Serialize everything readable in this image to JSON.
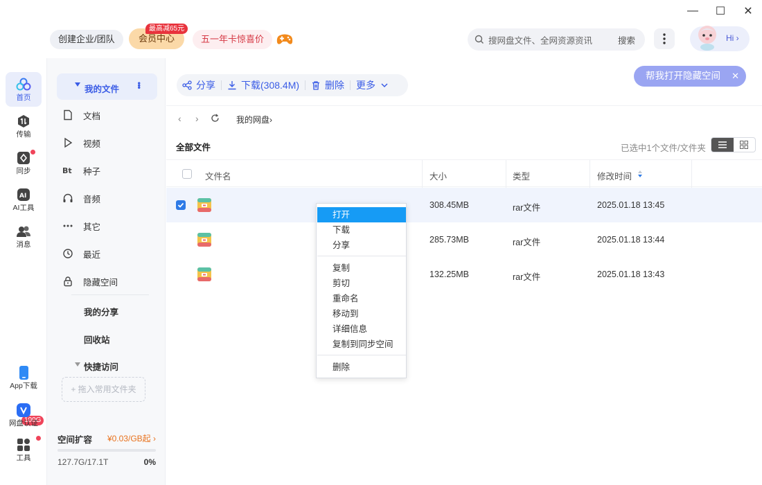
{
  "window": {
    "minimize": "—",
    "maximize": "☐",
    "close": "✕"
  },
  "topbar": {
    "enterprise": "创建企业/团队",
    "vip_tag": "最高减65元",
    "vip": "会员中心",
    "promo": "五一年卡惊喜价",
    "search_placeholder": "搜网盘文件、全网资源资讯",
    "search_go": "搜索",
    "hi": "Hi ›"
  },
  "rail": {
    "items": [
      {
        "label": "首页",
        "icon": "cloud-icon"
      },
      {
        "label": "传输",
        "icon": "transfer-icon"
      },
      {
        "label": "同步",
        "icon": "sync-icon"
      },
      {
        "label": "AI工具",
        "icon": "ai-icon"
      },
      {
        "label": "消息",
        "icon": "message-icon"
      }
    ],
    "app_badge": "100G",
    "app_download": "App下载",
    "verify": "网盘认证",
    "tools": "工具"
  },
  "sidebar": {
    "my_files": "我的文件",
    "items": [
      {
        "label": "文档",
        "icon": "document-icon"
      },
      {
        "label": "视频",
        "icon": "video-icon"
      },
      {
        "label": "种子",
        "icon": "torrent-icon"
      },
      {
        "label": "音频",
        "icon": "audio-icon"
      },
      {
        "label": "其它",
        "icon": "other-icon"
      },
      {
        "label": "最近",
        "icon": "recent-icon"
      },
      {
        "label": "隐藏空间",
        "icon": "lock-icon"
      }
    ],
    "my_share": "我的分享",
    "recycle": "回收站",
    "quick_access": "快捷访问",
    "drop_hint": "+ 拖入常用文件夹",
    "space_title": "空间扩容",
    "space_price": "¥0.03/GB起 ›",
    "space_used": "127.7G/17.1T",
    "space_pct": "0%",
    "space_fraction": 0.0
  },
  "toolbar": {
    "share": "分享",
    "download": "下载(308.4M)",
    "delete": "删除",
    "more": "更多"
  },
  "hidden_space_btn": "帮我打开隐藏空间",
  "breadcrumb": "我的网盘›",
  "list": {
    "title": "全部文件",
    "selection_info": "已选中1个文件/文件夹",
    "columns": [
      "文件名",
      "大小",
      "类型",
      "修改时间"
    ],
    "rows": [
      {
        "size": "308.45MB",
        "type": "rar文件",
        "modified": "2025.01.18 13:45",
        "selected": true
      },
      {
        "size": "285.73MB",
        "type": "rar文件",
        "modified": "2025.01.18 13:44",
        "selected": false
      },
      {
        "size": "132.25MB",
        "type": "rar文件",
        "modified": "2025.01.18 13:43",
        "selected": false
      }
    ]
  },
  "context_menu": {
    "items": [
      "打开",
      "下载",
      "分享",
      "复制",
      "剪切",
      "重命名",
      "移动到",
      "详细信息",
      "复制到同步空间",
      "删除"
    ]
  }
}
